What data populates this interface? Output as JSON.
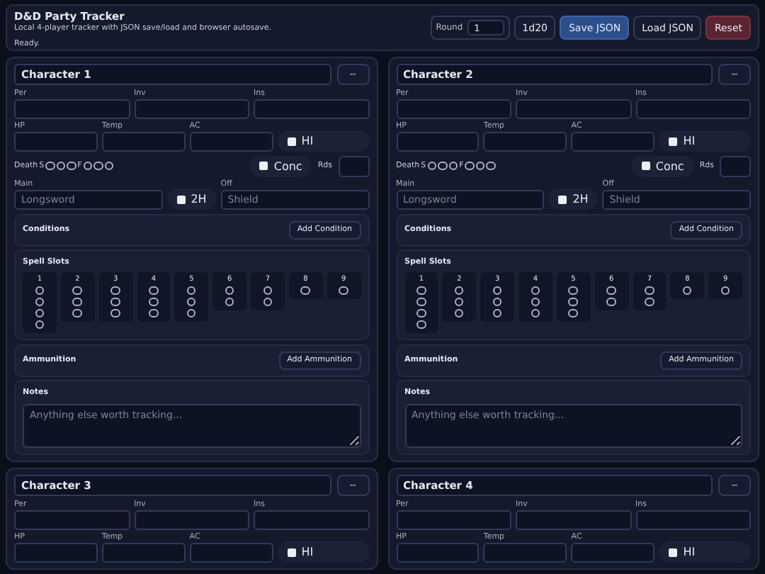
{
  "app": {
    "title": "D&D Party Tracker",
    "subtitle": "Local 4-player tracker with JSON save/load and browser autosave.",
    "status": "Ready."
  },
  "toolbar": {
    "round_label": "Round",
    "round_value": "1",
    "buttons": [
      {
        "label": "1d20",
        "kind": "plain"
      },
      {
        "label": "Save JSON",
        "kind": "primary"
      },
      {
        "label": "Load JSON",
        "kind": "plain"
      },
      {
        "label": "Reset",
        "kind": "danger"
      }
    ]
  },
  "characters": [
    {
      "name": "Character 1",
      "menu_button": "--",
      "stats_top": [
        {
          "label": "Per"
        },
        {
          "label": "Inv"
        },
        {
          "label": "Ins"
        }
      ],
      "stats_mid": [
        {
          "label": "HP"
        },
        {
          "label": "Temp"
        },
        {
          "label": "AC"
        }
      ],
      "hi": {
        "label": "HI",
        "checked": false
      },
      "death": {
        "label": "Death",
        "success_label": "S",
        "failure_label": "F",
        "successes": [
          false,
          false,
          false
        ],
        "failures": [
          false,
          false,
          false
        ]
      },
      "conc": {
        "label": "Conc",
        "checked": false
      },
      "rounds_label": "Rds",
      "weapons": {
        "main_label": "Main",
        "main_placeholder": "Longsword",
        "two_handed": {
          "label": "2H",
          "checked": false
        },
        "off_label": "Off",
        "off_placeholder": "Shield"
      },
      "sections": [
        {
          "kind": "list",
          "title": "Conditions",
          "button": "Add Condition"
        },
        {
          "kind": "slots",
          "title": "Spell Slots",
          "levels": [
            {
              "label": "1",
              "slots": [
                false,
                false,
                false,
                false
              ]
            },
            {
              "label": "2",
              "slots": [
                false,
                false,
                false
              ]
            },
            {
              "label": "3",
              "slots": [
                false,
                false,
                false
              ]
            },
            {
              "label": "4",
              "slots": [
                false,
                false,
                false
              ]
            },
            {
              "label": "5",
              "slots": [
                false,
                false,
                false
              ]
            },
            {
              "label": "6",
              "slots": [
                false,
                false
              ]
            },
            {
              "label": "7",
              "slots": [
                false,
                false
              ]
            },
            {
              "label": "8",
              "slots": [
                false
              ]
            },
            {
              "label": "9",
              "slots": [
                false
              ]
            }
          ]
        },
        {
          "kind": "list",
          "title": "Ammunition",
          "button": "Add Ammunition"
        },
        {
          "kind": "notes",
          "title": "Notes",
          "placeholder": "Anything else worth tracking..."
        }
      ]
    },
    {
      "name": "Character 2",
      "menu_button": "--",
      "stats_top": [
        {
          "label": "Per"
        },
        {
          "label": "Inv"
        },
        {
          "label": "Ins"
        }
      ],
      "stats_mid": [
        {
          "label": "HP"
        },
        {
          "label": "Temp"
        },
        {
          "label": "AC"
        }
      ],
      "hi": {
        "label": "HI",
        "checked": false
      },
      "death": {
        "label": "Death",
        "success_label": "S",
        "failure_label": "F",
        "successes": [
          false,
          false,
          false
        ],
        "failures": [
          false,
          false,
          false
        ]
      },
      "conc": {
        "label": "Conc",
        "checked": false
      },
      "rounds_label": "Rds",
      "weapons": {
        "main_label": "Main",
        "main_placeholder": "Longsword",
        "two_handed": {
          "label": "2H",
          "checked": false
        },
        "off_label": "Off",
        "off_placeholder": "Shield"
      },
      "sections": [
        {
          "kind": "list",
          "title": "Conditions",
          "button": "Add Condition"
        },
        {
          "kind": "slots",
          "title": "Spell Slots",
          "levels": [
            {
              "label": "1",
              "slots": [
                false,
                false,
                false,
                false
              ]
            },
            {
              "label": "2",
              "slots": [
                false,
                false,
                false
              ]
            },
            {
              "label": "3",
              "slots": [
                false,
                false,
                false
              ]
            },
            {
              "label": "4",
              "slots": [
                false,
                false,
                false
              ]
            },
            {
              "label": "5",
              "slots": [
                false,
                false,
                false
              ]
            },
            {
              "label": "6",
              "slots": [
                false,
                false
              ]
            },
            {
              "label": "7",
              "slots": [
                false,
                false
              ]
            },
            {
              "label": "8",
              "slots": [
                false
              ]
            },
            {
              "label": "9",
              "slots": [
                false
              ]
            }
          ]
        },
        {
          "kind": "list",
          "title": "Ammunition",
          "button": "Add Ammunition"
        },
        {
          "kind": "notes",
          "title": "Notes",
          "placeholder": "Anything else worth tracking..."
        }
      ]
    },
    {
      "name": "Character 3",
      "menu_button": "--",
      "stats_top": [
        {
          "label": "Per"
        },
        {
          "label": "Inv"
        },
        {
          "label": "Ins"
        }
      ],
      "stats_mid": [
        {
          "label": "HP"
        },
        {
          "label": "Temp"
        },
        {
          "label": "AC"
        }
      ],
      "hi": {
        "label": "HI",
        "checked": false
      }
    },
    {
      "name": "Character 4",
      "menu_button": "--",
      "stats_top": [
        {
          "label": "Per"
        },
        {
          "label": "Inv"
        },
        {
          "label": "Ins"
        }
      ],
      "stats_mid": [
        {
          "label": "HP"
        },
        {
          "label": "Temp"
        },
        {
          "label": "AC"
        }
      ],
      "hi": {
        "label": "HI",
        "checked": false
      }
    }
  ]
}
